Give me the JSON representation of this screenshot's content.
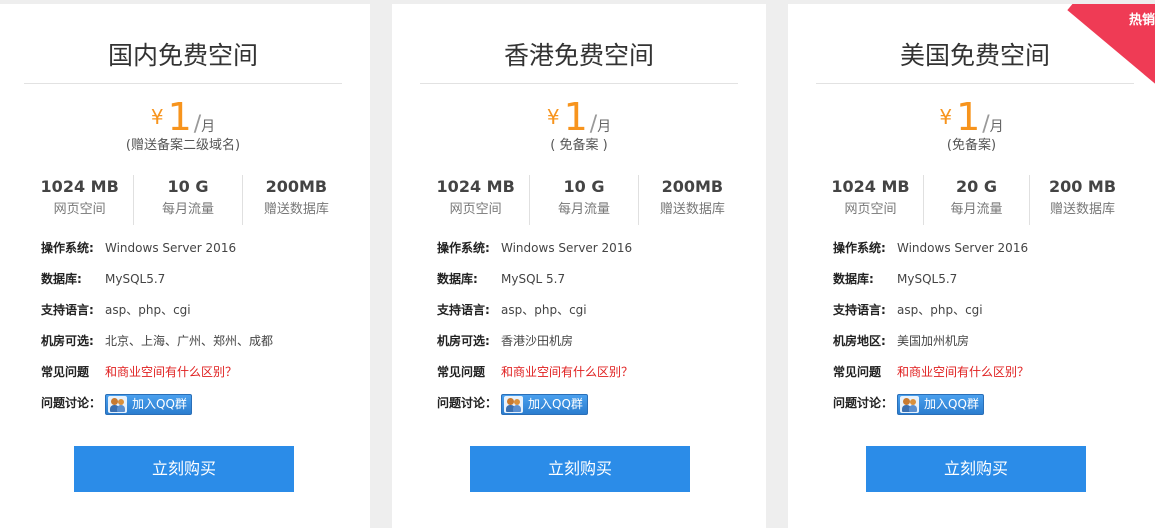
{
  "plans": [
    {
      "title": "国内免费空间",
      "price_currency": "¥",
      "price_amount": "1",
      "price_slash": "/",
      "price_unit": "月",
      "gift": "(赠送备案二级域名)",
      "stats": [
        {
          "num": "1024 MB",
          "label": "网页空间"
        },
        {
          "num": "10 G",
          "label": "每月流量"
        },
        {
          "num": "200MB",
          "label": "赠送数据库"
        }
      ],
      "specs": {
        "os_label": "操作系统:",
        "os_value": "Windows Server 2016",
        "db_label": "数据库:",
        "db_value": "MySQL5.7",
        "lang_label": "支持语言:",
        "lang_value": "asp、php、cgi",
        "room_label": "机房可选:",
        "room_value": "北京、上海、广州、郑州、成都",
        "faq_label": "常见问题",
        "faq_link": "和商业空间有什么区别？",
        "discuss_label": "问题讨论：",
        "qq_label": "加入QQ群"
      },
      "buy_label": "立刻购买"
    },
    {
      "title": "香港免费空间",
      "price_currency": "¥",
      "price_amount": "1",
      "price_slash": "/",
      "price_unit": "月",
      "gift": "( 免备案 )",
      "stats": [
        {
          "num": "1024 MB",
          "label": "网页空间"
        },
        {
          "num": "10 G",
          "label": "每月流量"
        },
        {
          "num": "200MB",
          "label": "赠送数据库"
        }
      ],
      "specs": {
        "os_label": "操作系统:",
        "os_value": "Windows Server 2016",
        "db_label": "数据库:",
        "db_value": "MySQL 5.7",
        "lang_label": "支持语言:",
        "lang_value": "asp、php、cgi",
        "room_label": "机房可选:",
        "room_value": "香港沙田机房",
        "faq_label": "常见问题",
        "faq_link": "和商业空间有什么区别？",
        "discuss_label": "问题讨论：",
        "qq_label": "加入QQ群"
      },
      "buy_label": "立刻购买"
    },
    {
      "title": "美国免费空间",
      "price_currency": "¥",
      "price_amount": "1",
      "price_slash": "/",
      "price_unit": "月",
      "gift": "(免备案)",
      "stats": [
        {
          "num": "1024 MB",
          "label": "网页空间"
        },
        {
          "num": "20 G",
          "label": "每月流量"
        },
        {
          "num": "200 MB",
          "label": "赠送数据库"
        }
      ],
      "specs": {
        "os_label": "操作系统:",
        "os_value": "Windows Server 2016",
        "db_label": "数据库:",
        "db_value": "MySQL5.7",
        "lang_label": "支持语言:",
        "lang_value": "asp、php、cgi",
        "room_label": "机房地区:",
        "room_value": "美国加州机房",
        "faq_label": "常见问题",
        "faq_link": "和商业空间有什么区别？",
        "discuss_label": "问题讨论：",
        "qq_label": "加入QQ群"
      },
      "buy_label": "立刻购买",
      "badge": "热销"
    }
  ],
  "colors": {
    "price": "#f7941d",
    "button": "#2b8ce8",
    "link": "#e02020",
    "badge": "#ef3b55"
  },
  "icons": {
    "qq_group": "qq-group-icon"
  }
}
